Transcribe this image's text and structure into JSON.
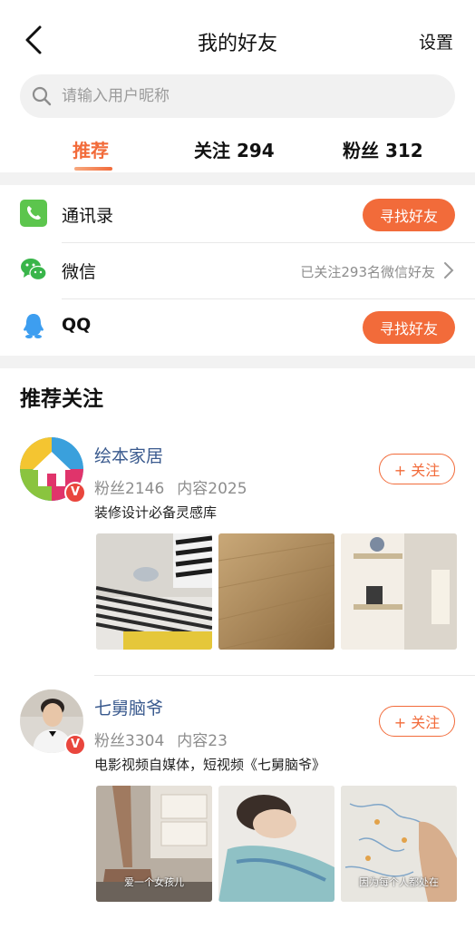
{
  "header": {
    "title": "我的好友",
    "settings_label": "设置"
  },
  "search": {
    "placeholder": "请输入用户昵称"
  },
  "tabs": [
    {
      "label": "推荐",
      "active": true
    },
    {
      "label": "关注 294",
      "active": false
    },
    {
      "label": "粉丝 312",
      "active": false
    }
  ],
  "contacts": {
    "address_book": {
      "label": "通讯录",
      "button": "寻找好友"
    },
    "wechat": {
      "label": "微信",
      "status": "已关注293名微信好友"
    },
    "qq": {
      "label": "QQ",
      "button": "寻找好友"
    }
  },
  "recommended": {
    "title": "推荐关注",
    "users": [
      {
        "name": "绘本家居",
        "fans": "粉丝2146",
        "content": "内容2025",
        "desc": "装修设计必备灵感库",
        "follow_label": "+ 关注",
        "verified_badge": "V",
        "thumb_captions": [
          "",
          "",
          ""
        ]
      },
      {
        "name": "七舅脑爷",
        "fans": "粉丝3304",
        "content": "内容23",
        "desc": "电影视频自媒体，短视频《七舅脑爷》",
        "follow_label": "+ 关注",
        "verified_badge": "V",
        "thumb_captions": [
          "爱一个女孩儿",
          "",
          "因为每个人都处在"
        ]
      }
    ]
  },
  "colors": {
    "accent": "#f26b3a",
    "link_blue": "#3a5a8e",
    "verified": "#e9463d",
    "wechat_green": "#39b54a"
  }
}
